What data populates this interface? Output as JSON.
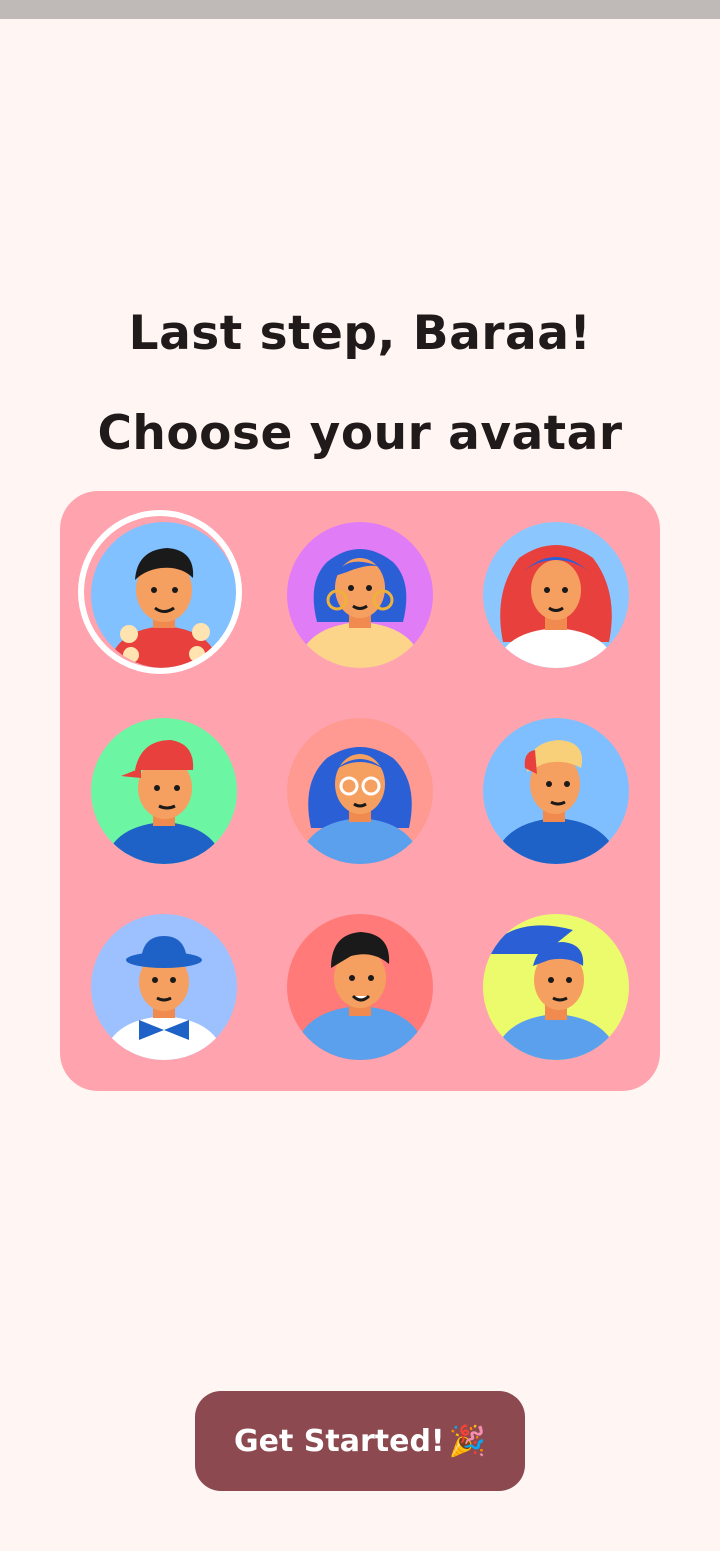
{
  "header": {
    "greeting": "Last step, Baraa!",
    "prompt": "Choose your avatar"
  },
  "avatars": {
    "selected_index": 0,
    "items": [
      {
        "name": "avatar-hawaiian-shirt",
        "bg": "#82c1ff"
      },
      {
        "name": "avatar-hoop-earrings",
        "bg": "#e07cf6"
      },
      {
        "name": "avatar-red-hair-bandana",
        "bg": "#8cc6ff"
      },
      {
        "name": "avatar-red-cap",
        "bg": "#6cf5a3"
      },
      {
        "name": "avatar-glasses",
        "bg": "#ff9a92"
      },
      {
        "name": "avatar-blond-quiff",
        "bg": "#7fbfff"
      },
      {
        "name": "avatar-bowler-hat",
        "bg": "#9dc0ff"
      },
      {
        "name": "avatar-hoodie",
        "bg": "#ff7a78"
      },
      {
        "name": "avatar-blue-ponytail",
        "bg": "#ecfb6c"
      }
    ]
  },
  "cta": {
    "label": "Get Started!",
    "emoji": "🎉"
  },
  "colors": {
    "background": "#fff6f4",
    "grid_card": "#ffa4ae",
    "button": "#8c4a50",
    "text": "#201a1a"
  }
}
